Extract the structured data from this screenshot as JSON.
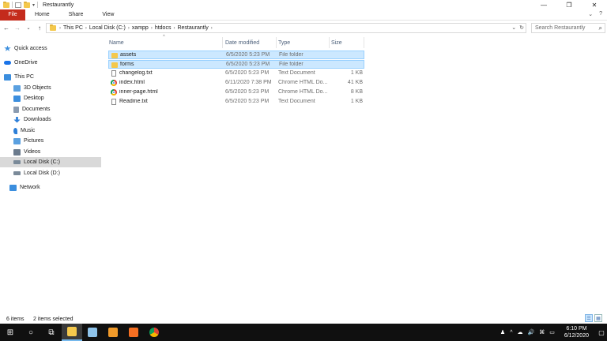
{
  "window": {
    "title": "Restaurantly",
    "controls": [
      "—",
      "❐",
      "✕"
    ]
  },
  "ribbon": {
    "file": "File",
    "tabs": [
      "Home",
      "Share",
      "View"
    ],
    "right_icons": [
      "⌄",
      "?"
    ]
  },
  "address": {
    "back": "←",
    "forward": "→",
    "dropdown": "⌄",
    "up": "↑",
    "crumbs": [
      "This PC",
      "Local Disk (C:)",
      "xampp",
      "htdocs",
      "Restaurantly"
    ],
    "crumb_sep": "›",
    "refresh": "↻",
    "history": "⌄",
    "search_placeholder": "Search Restaurantly",
    "search_icon": "⌕"
  },
  "nav": {
    "items": [
      {
        "label": "Quick access",
        "icon": "star-icon",
        "color": "#3b8ede"
      },
      {
        "label": "OneDrive",
        "icon": "cloud-icon",
        "color": "#1a73e8"
      },
      {
        "label": "This PC",
        "icon": "computer-icon",
        "color": "#3b8ede"
      },
      {
        "label": "3D Objects",
        "icon": "cube-icon",
        "color": "#5aa0e0"
      },
      {
        "label": "Desktop",
        "icon": "desktop-icon",
        "color": "#3b8ede"
      },
      {
        "label": "Documents",
        "icon": "document-icon",
        "color": "#8a9bb0"
      },
      {
        "label": "Downloads",
        "icon": "download-icon",
        "color": "#2d7fd8"
      },
      {
        "label": "Music",
        "icon": "music-icon",
        "color": "#2d7fd8"
      },
      {
        "label": "Pictures",
        "icon": "picture-icon",
        "color": "#5aa0e0"
      },
      {
        "label": "Videos",
        "icon": "video-icon",
        "color": "#6b7b8d"
      },
      {
        "label": "Local Disk (C:)",
        "icon": "drive-icon",
        "color": "#7a8a99"
      },
      {
        "label": "Local Disk (D:)",
        "icon": "drive-icon",
        "color": "#7a8a99"
      },
      {
        "label": "Network",
        "icon": "network-icon",
        "color": "#3b8ede"
      }
    ]
  },
  "columns": {
    "name": "Name",
    "date": "Date modified",
    "type": "Type",
    "size": "Size",
    "sort_arrow": "^"
  },
  "files": [
    {
      "name": "assets",
      "date": "6/5/2020 5:23 PM",
      "type": "File folder",
      "size": "",
      "icon": "folder-icon"
    },
    {
      "name": "forms",
      "date": "6/5/2020 5:23 PM",
      "type": "File folder",
      "size": "",
      "icon": "folder-icon"
    },
    {
      "name": "changelog.txt",
      "date": "6/5/2020 5:23 PM",
      "type": "Text Document",
      "size": "1 KB",
      "icon": "text-file-icon"
    },
    {
      "name": "index.html",
      "date": "6/11/2020 7:38 PM",
      "type": "Chrome HTML Do...",
      "size": "41 KB",
      "icon": "chrome-icon"
    },
    {
      "name": "inner-page.html",
      "date": "6/5/2020 5:23 PM",
      "type": "Chrome HTML Do...",
      "size": "8 KB",
      "icon": "chrome-icon"
    },
    {
      "name": "Readme.txt",
      "date": "6/5/2020 5:23 PM",
      "type": "Text Document",
      "size": "1 KB",
      "icon": "text-file-icon"
    }
  ],
  "status": {
    "count": "6 items",
    "selected": "2 items selected"
  },
  "taskbar": {
    "start": "⊞",
    "search": "○",
    "taskview": "⧉",
    "apps": [
      {
        "name": "file-explorer-icon",
        "color": "#f4c84c"
      },
      {
        "name": "notepad-icon",
        "color": "#8ec3ea"
      },
      {
        "name": "sublime-icon",
        "color": "#f09a2a"
      },
      {
        "name": "xampp-icon",
        "color": "#f56f22"
      },
      {
        "name": "chrome-icon",
        "color": "#db4437"
      }
    ],
    "tray_icons": [
      "♟",
      "^",
      "☁",
      "🔊",
      "⌘",
      "▭"
    ],
    "time": "6:10 PM",
    "date": "6/12/2020",
    "notifications": "▢"
  }
}
